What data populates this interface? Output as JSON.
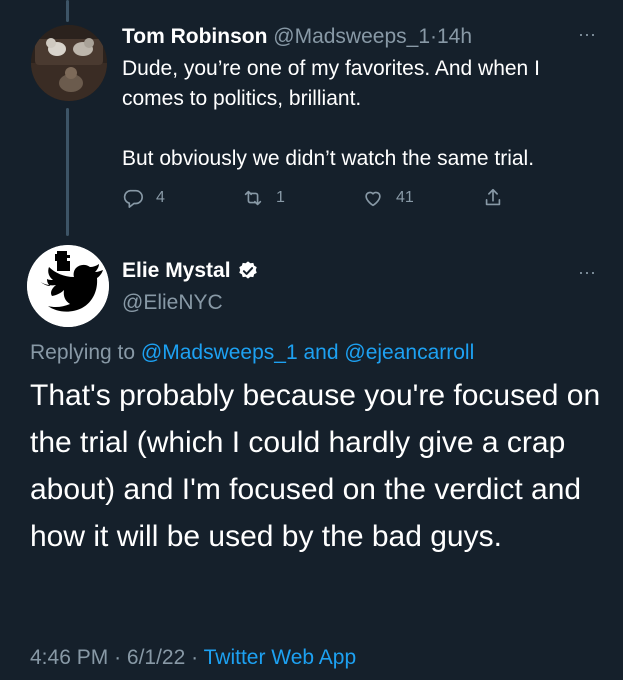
{
  "parent_tweet": {
    "display_name": "Tom Robinson",
    "handle": "@Madsweeps_1",
    "separator": "·",
    "time": "14h",
    "more_glyph": "···",
    "body_line_1": "Dude, you’re one of my favorites.  And when I comes to politics, brilliant.",
    "body_line_2": "But obviously we didn’t watch the same trial.",
    "actions": {
      "reply": {
        "icon": "reply-icon",
        "count": "4"
      },
      "retweet": {
        "icon": "retweet-icon",
        "count": "1"
      },
      "like": {
        "icon": "heart-icon",
        "count": "41"
      },
      "share": {
        "icon": "share-icon",
        "count": ""
      }
    }
  },
  "main_tweet": {
    "display_name": "Elie Mystal",
    "verified": true,
    "handle": "@ElieNYC",
    "more_glyph": "···",
    "replying_prefix": "Replying to",
    "replying_user_1": "@Madsweeps_1",
    "replying_and": "and",
    "replying_user_2": "@ejeancarroll",
    "text": "That's probably because you're focused on the trial (which I could hardly give a crap about) and I'm focused on the verdict and how it will be used by the bad guys.",
    "time": "4:46 PM",
    "dot": "·",
    "date": "6/1/22",
    "app": "Twitter Web App"
  },
  "colors": {
    "background": "#15202b",
    "secondary_text": "#8899a6",
    "link": "#1da1f2",
    "thread_line": "#3d5466"
  }
}
